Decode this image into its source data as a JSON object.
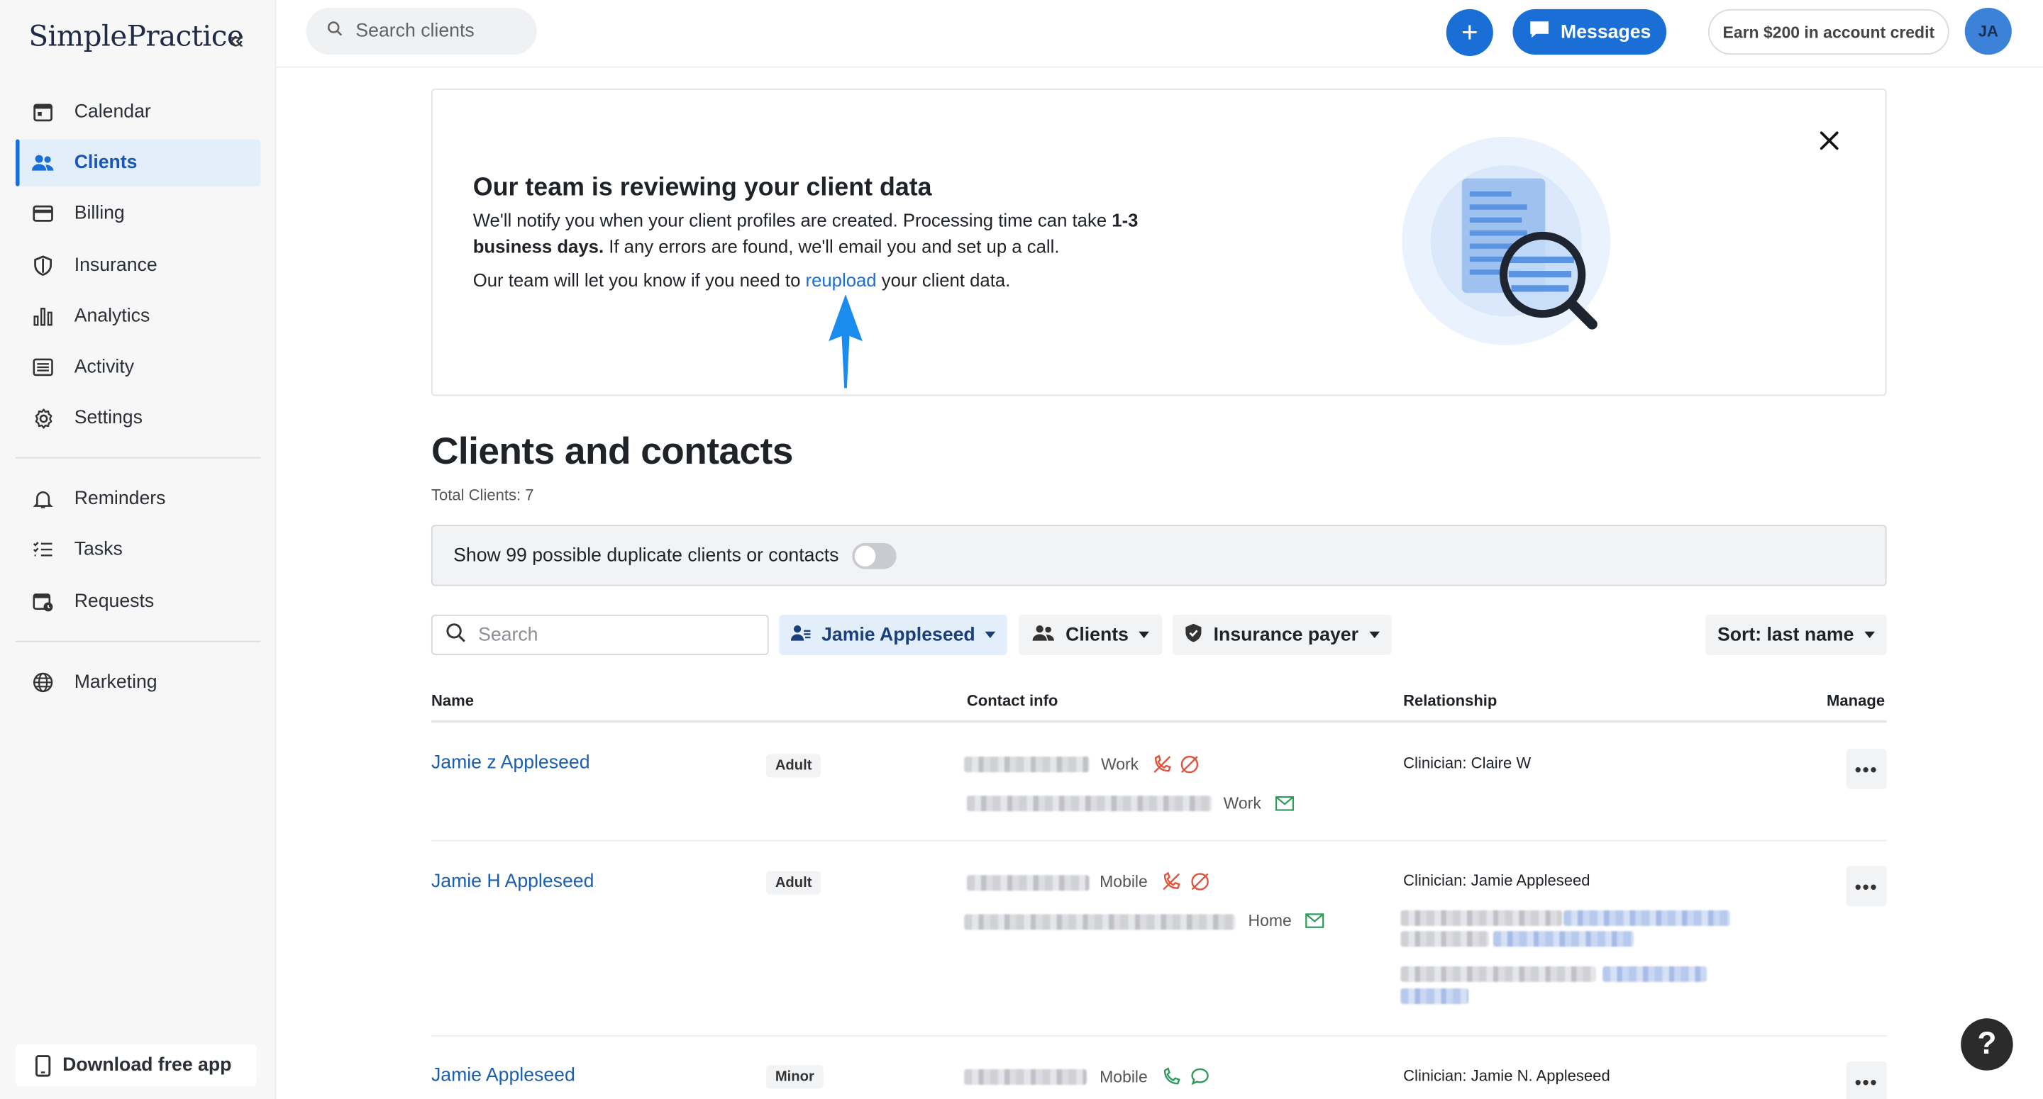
{
  "sidebar": {
    "logo": "SimplePractice",
    "nav_main": [
      {
        "label": "Calendar",
        "icon": "calendar-icon"
      },
      {
        "label": "Clients",
        "icon": "users-icon",
        "active": true
      },
      {
        "label": "Billing",
        "icon": "credit-card-icon"
      },
      {
        "label": "Insurance",
        "icon": "shield-icon"
      },
      {
        "label": "Analytics",
        "icon": "bar-chart-icon"
      },
      {
        "label": "Activity",
        "icon": "list-icon"
      },
      {
        "label": "Settings",
        "icon": "gear-icon"
      }
    ],
    "nav_secondary": [
      {
        "label": "Reminders",
        "icon": "bell-icon"
      },
      {
        "label": "Tasks",
        "icon": "checklist-icon"
      },
      {
        "label": "Requests",
        "icon": "calendar-request-icon"
      }
    ],
    "nav_tertiary": [
      {
        "label": "Marketing",
        "icon": "globe-icon"
      }
    ],
    "download_label": "Download free app"
  },
  "topbar": {
    "search_placeholder": "Search clients",
    "messages_label": "Messages",
    "earn_label": "Earn $200 in account credit",
    "avatar_initials": "JA"
  },
  "banner": {
    "title": "Our team is reviewing your client data",
    "line1_a": "We'll notify you when your client profiles are created. Processing time can take ",
    "line1_bold": "1-3 business days.",
    "line1_b": " If any errors are found, we'll email you and set up a call.",
    "line2_a": "Our team will let you know if you need to ",
    "line2_link": "reupload",
    "line2_b": " your client data."
  },
  "page": {
    "title": "Clients and contacts",
    "total": "Total Clients: 7",
    "duplicates_label": "Show 99 possible duplicate clients or contacts"
  },
  "filters": {
    "search_placeholder": "Search",
    "clinician": "Jamie Appleseed",
    "clients": "Clients",
    "insurance": "Insurance payer",
    "sort": "Sort: last name"
  },
  "table": {
    "headers": {
      "name": "Name",
      "contact": "Contact info",
      "relationship": "Relationship",
      "manage": "Manage"
    },
    "rows": [
      {
        "name": "Jamie z Appleseed",
        "badge": "Adult",
        "phone_type": "Work",
        "email_type": "Work",
        "relationship": "Clinician: Claire W"
      },
      {
        "name": "Jamie H Appleseed",
        "badge": "Adult",
        "phone_type": "Mobile",
        "email_type": "Home",
        "relationship": "Clinician: Jamie Appleseed"
      },
      {
        "name": "Jamie Appleseed",
        "badge": "Minor",
        "phone_type": "Mobile",
        "relationship": "Clinician: Jamie N. Appleseed"
      }
    ],
    "manage_label": "•••"
  },
  "help_label": "?",
  "colors": {
    "accent": "#1a6fd6",
    "link": "#1a5fb4",
    "active_bg": "#e3eefb",
    "warn": "#e0533d",
    "ok": "#2e9b5b"
  }
}
